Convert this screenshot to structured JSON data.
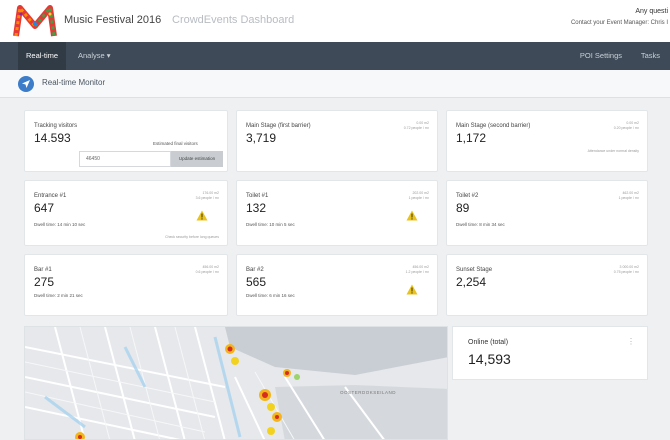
{
  "header": {
    "app_title": "Music Festival 2016",
    "app_subtitle": "CrowdEvents Dashboard",
    "user_question": "Any questi",
    "user_contact": "Contact your Event Manager: Chris I"
  },
  "nav": {
    "realtime": "Real-time",
    "analyse": "Analyse ▾",
    "poi_settings": "POI Settings",
    "tasks": "Tasks"
  },
  "page": {
    "title": "Real-time Monitor"
  },
  "tracking": {
    "title": "Tracking visitors",
    "value": "14.593",
    "estimated_label": "Estimated final visitors",
    "input_value": "46450",
    "button_label": "Update estimation"
  },
  "cards": [
    {
      "id": "main-stage-first",
      "title": "Main Stage (first barrier)",
      "value": "3,719",
      "meta1": "0.00 m2",
      "meta2": "0.72 people / m²",
      "dwell": "",
      "note": ""
    },
    {
      "id": "main-stage-second",
      "title": "Main Stage (second barrier)",
      "value": "1,172",
      "meta1": "0.00 m2",
      "meta2": "0.20 people / m²",
      "dwell": "",
      "note": "Attendance under normal density"
    },
    {
      "id": "entrance-1",
      "title": "Entrance #1",
      "value": "647",
      "meta1": "176.00 m2",
      "meta2": "3.6 people / m²",
      "dwell": "Dwell time: 14 min 10 sec",
      "note": "Check security before long queues"
    },
    {
      "id": "toilet-1",
      "title": "Toilet #1",
      "value": "132",
      "meta1": "202.00 m2",
      "meta2": "1 people / m²",
      "dwell": "Dwell time: 10 min 5 sec",
      "note": ""
    },
    {
      "id": "toilet-2",
      "title": "Toilet #2",
      "value": "89",
      "meta1": "462.00 m2",
      "meta2": "1 people / m²",
      "dwell": "Dwell time: 8 min 34 sec",
      "note": ""
    },
    {
      "id": "bar-1",
      "title": "Bar #1",
      "value": "275",
      "meta1": "456.00 m2",
      "meta2": "0.6 people / m²",
      "dwell": "Dwell time: 2 min 21 sec",
      "note": ""
    },
    {
      "id": "bar-2",
      "title": "Bar #2",
      "value": "565",
      "meta1": "456.00 m2",
      "meta2": "1.2 people / m²",
      "dwell": "Dwell time: 6 min 16 sec",
      "note": ""
    },
    {
      "id": "sunset-stage",
      "title": "Sunset Stage",
      "value": "2,254",
      "meta1": "3 000.00 m2",
      "meta2": "0.75 people / m²",
      "dwell": "",
      "note": ""
    }
  ],
  "map": {
    "area_label": "OOSTERDOKSEILAND"
  },
  "online": {
    "title": "Online (total)",
    "value": "14,593",
    "more": "⋮"
  },
  "colors": {
    "nav_bg": "#3e4a57",
    "accent": "#3c7cc8",
    "warning": "#e8c21e"
  }
}
